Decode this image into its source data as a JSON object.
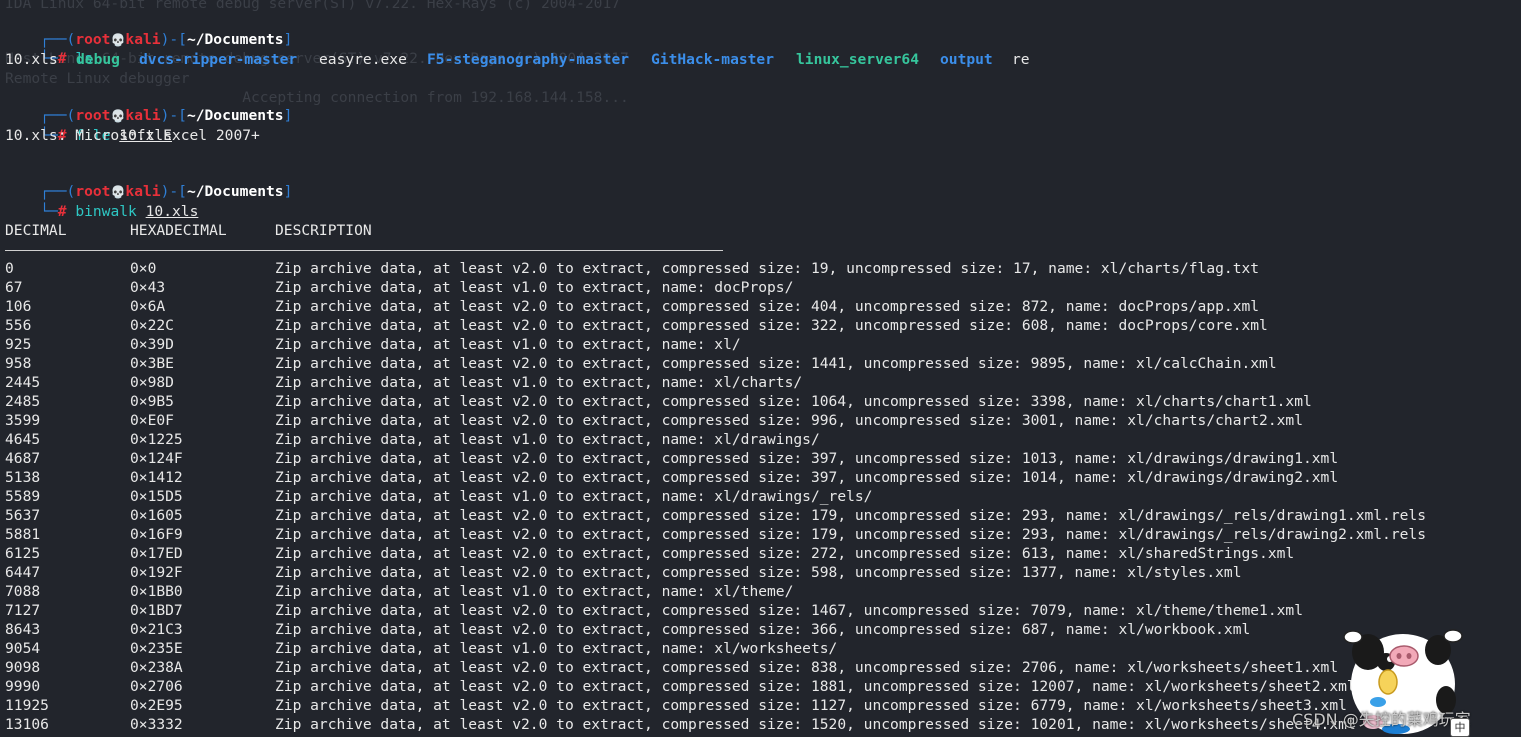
{
  "ghost_lines": [
    "IDA Linux 64-bit remote debug server(ST) v7.22. Hex-Rays (c) 2004-2017",
    "",
    "",
    "Host Linux 64-bit remote debug server(ST) v7.22. Hex-Rays (c) 2004-2017",
    "Remote Linux debugger",
    "                           Accepting connection from 192.168.144.158..."
  ],
  "prompt": {
    "user": "root",
    "skull": "💀",
    "host": "kali",
    "path": "~/Documents",
    "hash": "#",
    "open_top": "┌──(",
    "at_sep": ")-[",
    "close": "]",
    "open_bottom": "└─"
  },
  "commands": [
    {
      "cmd": "ls",
      "arg": ""
    },
    {
      "cmd": "file",
      "arg": "10.xls"
    },
    {
      "cmd": "binwalk",
      "arg": "10.xls"
    }
  ],
  "ls_output": [
    {
      "name": "10.xls",
      "type": "plain"
    },
    {
      "name": "debug",
      "type": "exec"
    },
    {
      "name": "dvcs-ripper-master",
      "type": "dir"
    },
    {
      "name": "easyre.exe",
      "type": "plain"
    },
    {
      "name": "F5-steganography-master",
      "type": "dir"
    },
    {
      "name": "GitHack-master",
      "type": "dir"
    },
    {
      "name": "linux_server64",
      "type": "exec"
    },
    {
      "name": "output",
      "type": "dir"
    },
    {
      "name": "re",
      "type": "plain"
    }
  ],
  "file_output": "10.xls: Microsoft Excel 2007+",
  "binwalk": {
    "headers": [
      "DECIMAL",
      "HEXADECIMAL",
      "DESCRIPTION"
    ],
    "rows": [
      [
        "0",
        "0×0",
        "Zip archive data, at least v2.0 to extract, compressed size: 19, uncompressed size: 17, name: xl/charts/flag.txt"
      ],
      [
        "67",
        "0×43",
        "Zip archive data, at least v1.0 to extract, name: docProps/"
      ],
      [
        "106",
        "0×6A",
        "Zip archive data, at least v2.0 to extract, compressed size: 404, uncompressed size: 872, name: docProps/app.xml"
      ],
      [
        "556",
        "0×22C",
        "Zip archive data, at least v2.0 to extract, compressed size: 322, uncompressed size: 608, name: docProps/core.xml"
      ],
      [
        "925",
        "0×39D",
        "Zip archive data, at least v1.0 to extract, name: xl/"
      ],
      [
        "958",
        "0×3BE",
        "Zip archive data, at least v2.0 to extract, compressed size: 1441, uncompressed size: 9895, name: xl/calcChain.xml"
      ],
      [
        "2445",
        "0×98D",
        "Zip archive data, at least v1.0 to extract, name: xl/charts/"
      ],
      [
        "2485",
        "0×9B5",
        "Zip archive data, at least v2.0 to extract, compressed size: 1064, uncompressed size: 3398, name: xl/charts/chart1.xml"
      ],
      [
        "3599",
        "0×E0F",
        "Zip archive data, at least v2.0 to extract, compressed size: 996, uncompressed size: 3001, name: xl/charts/chart2.xml"
      ],
      [
        "4645",
        "0×1225",
        "Zip archive data, at least v1.0 to extract, name: xl/drawings/"
      ],
      [
        "4687",
        "0×124F",
        "Zip archive data, at least v2.0 to extract, compressed size: 397, uncompressed size: 1013, name: xl/drawings/drawing1.xml"
      ],
      [
        "5138",
        "0×1412",
        "Zip archive data, at least v2.0 to extract, compressed size: 397, uncompressed size: 1014, name: xl/drawings/drawing2.xml"
      ],
      [
        "5589",
        "0×15D5",
        "Zip archive data, at least v1.0 to extract, name: xl/drawings/_rels/"
      ],
      [
        "5637",
        "0×1605",
        "Zip archive data, at least v2.0 to extract, compressed size: 179, uncompressed size: 293, name: xl/drawings/_rels/drawing1.xml.rels"
      ],
      [
        "5881",
        "0×16F9",
        "Zip archive data, at least v2.0 to extract, compressed size: 179, uncompressed size: 293, name: xl/drawings/_rels/drawing2.xml.rels"
      ],
      [
        "6125",
        "0×17ED",
        "Zip archive data, at least v2.0 to extract, compressed size: 272, uncompressed size: 613, name: xl/sharedStrings.xml"
      ],
      [
        "6447",
        "0×192F",
        "Zip archive data, at least v2.0 to extract, compressed size: 598, uncompressed size: 1377, name: xl/styles.xml"
      ],
      [
        "7088",
        "0×1BB0",
        "Zip archive data, at least v1.0 to extract, name: xl/theme/"
      ],
      [
        "7127",
        "0×1BD7",
        "Zip archive data, at least v2.0 to extract, compressed size: 1467, uncompressed size: 7079, name: xl/theme/theme1.xml"
      ],
      [
        "8643",
        "0×21C3",
        "Zip archive data, at least v2.0 to extract, compressed size: 366, uncompressed size: 687, name: xl/workbook.xml"
      ],
      [
        "9054",
        "0×235E",
        "Zip archive data, at least v1.0 to extract, name: xl/worksheets/"
      ],
      [
        "9098",
        "0×238A",
        "Zip archive data, at least v2.0 to extract, compressed size: 838, uncompressed size: 2706, name: xl/worksheets/sheet1.xml"
      ],
      [
        "9990",
        "0×2706",
        "Zip archive data, at least v2.0 to extract, compressed size: 1881, uncompressed size: 12007, name: xl/worksheets/sheet2.xml"
      ],
      [
        "11925",
        "0×2E95",
        "Zip archive data, at least v2.0 to extract, compressed size: 1127, uncompressed size: 6779, name: xl/worksheets/sheet3.xml"
      ],
      [
        "13106",
        "0×3332",
        "Zip archive data, at least v2.0 to extract, compressed size: 1520, uncompressed size: 10201, name: xl/worksheets/sheet4.xml"
      ]
    ]
  },
  "watermark": "CSDN @失控的菜鸡玩家",
  "ime_indicator": "中"
}
